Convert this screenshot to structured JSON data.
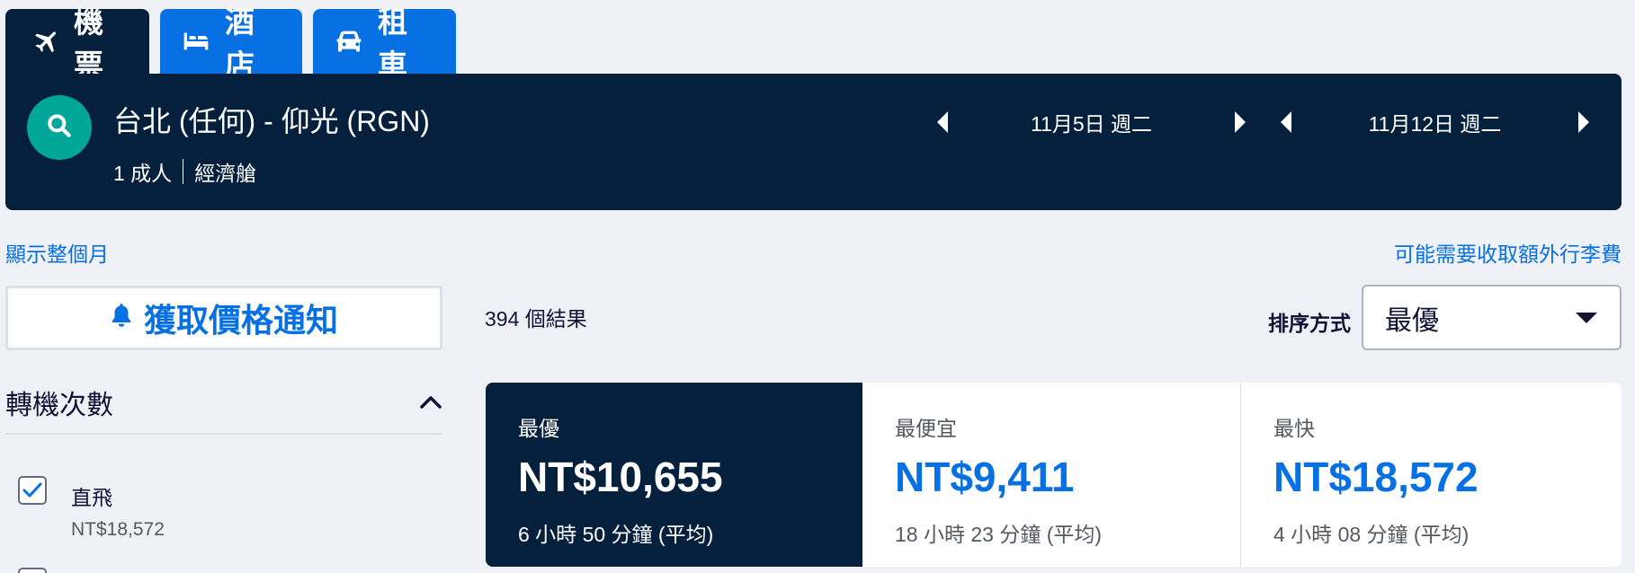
{
  "tabs": [
    {
      "label": "機票",
      "icon": "plane-icon"
    },
    {
      "label": "酒店",
      "icon": "bed-icon"
    },
    {
      "label": "租車",
      "icon": "car-icon"
    }
  ],
  "search": {
    "route": "台北 (任何) - 仰光 (RGN)",
    "passengers": "1 成人",
    "cabin": "經濟艙",
    "depart_date": "11月5日 週二",
    "return_date": "11月12日 週二"
  },
  "links": {
    "show_month": "顯示整個月",
    "baggage_fees": "可能需要收取額外行李費"
  },
  "price_alert_label": "獲取價格通知",
  "results_count": "394 個結果",
  "sort": {
    "label": "排序方式",
    "selected": "最優"
  },
  "filter": {
    "title": "轉機次數",
    "options": [
      {
        "label": "直飛",
        "price": "NT$18,572",
        "checked": true
      }
    ]
  },
  "sort_cards": [
    {
      "title": "最優",
      "price": "NT$10,655",
      "duration": "6 小時 50 分鐘 (平均)"
    },
    {
      "title": "最便宜",
      "price": "NT$9,411",
      "duration": "18 小時 23 分鐘 (平均)"
    },
    {
      "title": "最快",
      "price": "NT$18,572",
      "duration": "4 小時 08 分鐘 (平均)"
    }
  ],
  "colors": {
    "navy": "#05203c",
    "blue": "#0770e3",
    "teal": "#00a698",
    "background": "#eff1f6"
  }
}
